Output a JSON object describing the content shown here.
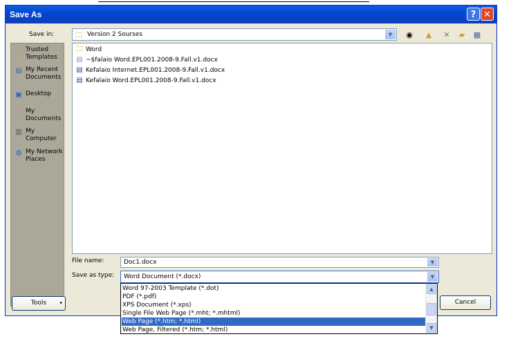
{
  "window": {
    "title": "Save As",
    "help_glyph": "?",
    "close_glyph": "✕"
  },
  "save_in": {
    "label": "Save in:",
    "value": "Version 2 Sourses"
  },
  "places": [
    {
      "label": "Trusted Templates",
      "icon": "folder-icon"
    },
    {
      "label": "My Recent Documents",
      "icon": "recent-documents-icon"
    },
    {
      "label": "Desktop",
      "icon": "desktop-icon"
    },
    {
      "label": "My Documents",
      "icon": "my-documents-icon"
    },
    {
      "label": "My Computer",
      "icon": "computer-icon"
    },
    {
      "label": "My Network Places",
      "icon": "network-icon"
    }
  ],
  "files": [
    {
      "name": "Word",
      "type": "folder"
    },
    {
      "name": "~$falaio Word.EPL001.2008-9.Fall.v1.docx",
      "type": "temp-doc"
    },
    {
      "name": "Kefalaio Internet.EPL001.2008-9.Fall.v1.docx",
      "type": "word-doc"
    },
    {
      "name": "Kefalaio Word.EPL001.2008-9.Fall.v1.docx",
      "type": "word-doc"
    }
  ],
  "file_name": {
    "label": "File name:",
    "value": "Doc1.docx"
  },
  "save_as_type": {
    "label": "Save as type:",
    "value": "Word Document (*.docx)",
    "options": [
      "Word 97-2003 Template (*.dot)",
      "PDF (*.pdf)",
      "XPS Document (*.xps)",
      "Single File Web Page (*.mht; *.mhtml)",
      "Web Page (*.htm; *.html)",
      "Web Page, Filtered (*.htm; *.html)"
    ],
    "selected_index": 4
  },
  "buttons": {
    "tools": "Tools",
    "cancel": "Cancel"
  },
  "colors": {
    "title_bar": "#0a5fe0",
    "dialog_bg": "#ece9d8",
    "selection": "#316ac5"
  }
}
